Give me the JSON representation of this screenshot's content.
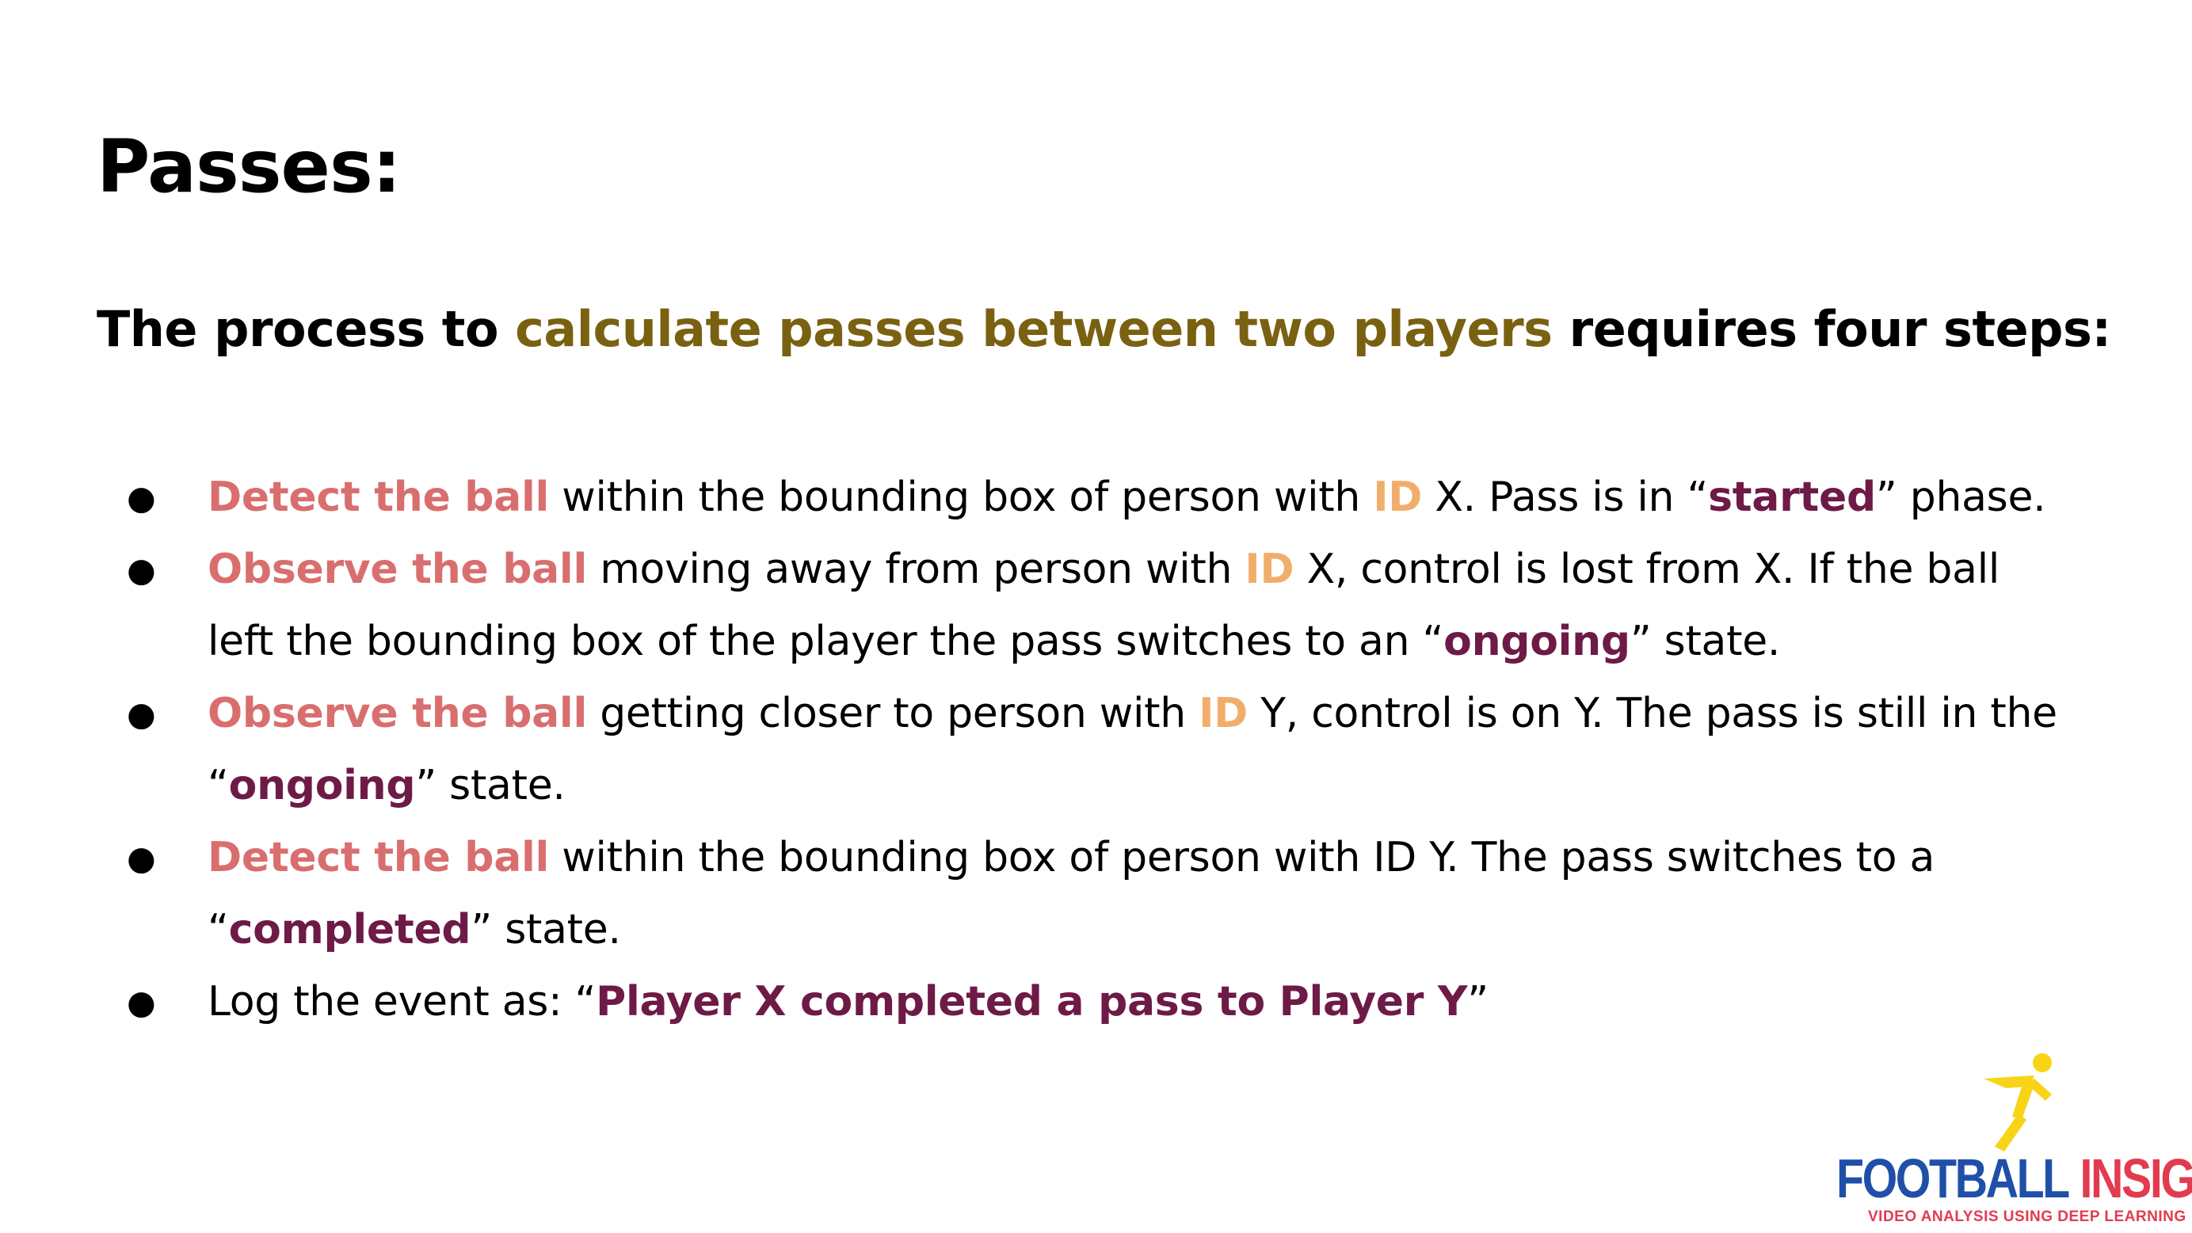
{
  "slide": {
    "title": "Passes:",
    "intro": {
      "prefix": "The process to ",
      "highlight": "calculate passes between two players",
      "suffix": " requires four steps:"
    },
    "bullet_symbol": "●",
    "steps": [
      {
        "a": "Detect the ball",
        "b": " within the bounding box of person with ",
        "c": "ID",
        "d": " X. Pass is in “",
        "e": "started",
        "f": "” phase."
      },
      {
        "a": "Observe the ball",
        "b": " moving away from person with ",
        "c": "ID",
        "d": " X, control is lost from X. If the ball left the bounding box of the player the pass switches to an “",
        "e": "ongoing",
        "f": "” state."
      },
      {
        "a": "Observe the ball",
        "b": " getting closer to person with ",
        "c": "ID",
        "d": " Y, control is on Y. The pass is still in the “",
        "e": "ongoing",
        "f": "” state."
      },
      {
        "a": "Detect the ball",
        "b": " within the bounding box of person with ID Y. The pass switches to a “",
        "e": "completed",
        "f": "” state."
      },
      {
        "b": "Log the event as: “",
        "e": "Player X completed a pass to Player Y",
        "f": "”"
      }
    ]
  },
  "logo": {
    "word1": "FOOTBALL",
    "word2": "INSIGHTS",
    "tagline": "VIDEO ANALYSIS USING DEEP LEARNING",
    "mark_icon": "running-player-icon",
    "colors": {
      "blue": "#1f4fa8",
      "red": "#e23b4f",
      "yellow": "#f7d417"
    }
  },
  "colors": {
    "gold": "#7a6111",
    "coral": "#d96e6e",
    "orange": "#f1ae6b",
    "plum": "#6e1a47"
  }
}
